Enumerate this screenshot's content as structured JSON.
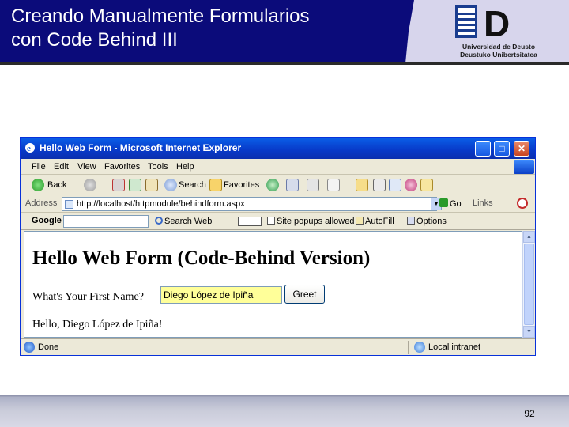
{
  "slide": {
    "title_line1": "Creando Manualmente Formularios",
    "title_line2": "con Code Behind III",
    "logo_line1": "Universidad de Deusto",
    "logo_line2": "Deustuko Unibertsitatea",
    "logo_letter": "D",
    "page_number": "92",
    "colors": {
      "header": "#0b0b7a",
      "header_panel": "#d7d5ec",
      "footer": "#c9cbd9"
    }
  },
  "browser": {
    "title": "Hello Web Form - Microsoft Internet Explorer",
    "window_buttons": {
      "minimize": "_",
      "maximize": "□",
      "close": "✕"
    },
    "menu": [
      "File",
      "Edit",
      "View",
      "Favorites",
      "Tools",
      "Help"
    ],
    "toolbar": {
      "back": "Back",
      "search": "Search",
      "favorites": "Favorites"
    },
    "address": {
      "label": "Address",
      "url": "http://localhost/httpmodule/behindform.aspx",
      "go": "Go",
      "links": "Links"
    },
    "google_toolbar": {
      "label": "Google",
      "search_web": "Search Web",
      "popups": "Site popups allowed",
      "autofill": "AutoFill",
      "options": "Options"
    },
    "status": {
      "text": "Done",
      "zone": "Local intranet"
    },
    "colors": {
      "titlebar": "#0839c8",
      "chrome": "#ece9d8",
      "input_highlight": "#ffff99"
    }
  },
  "page": {
    "heading": "Hello Web Form (Code-Behind Version)",
    "prompt": "What's Your First Name?",
    "name_value": "Diego López de Ipiña",
    "greet_button": "Greet",
    "result": "Hello, Diego López de Ipiña!"
  }
}
